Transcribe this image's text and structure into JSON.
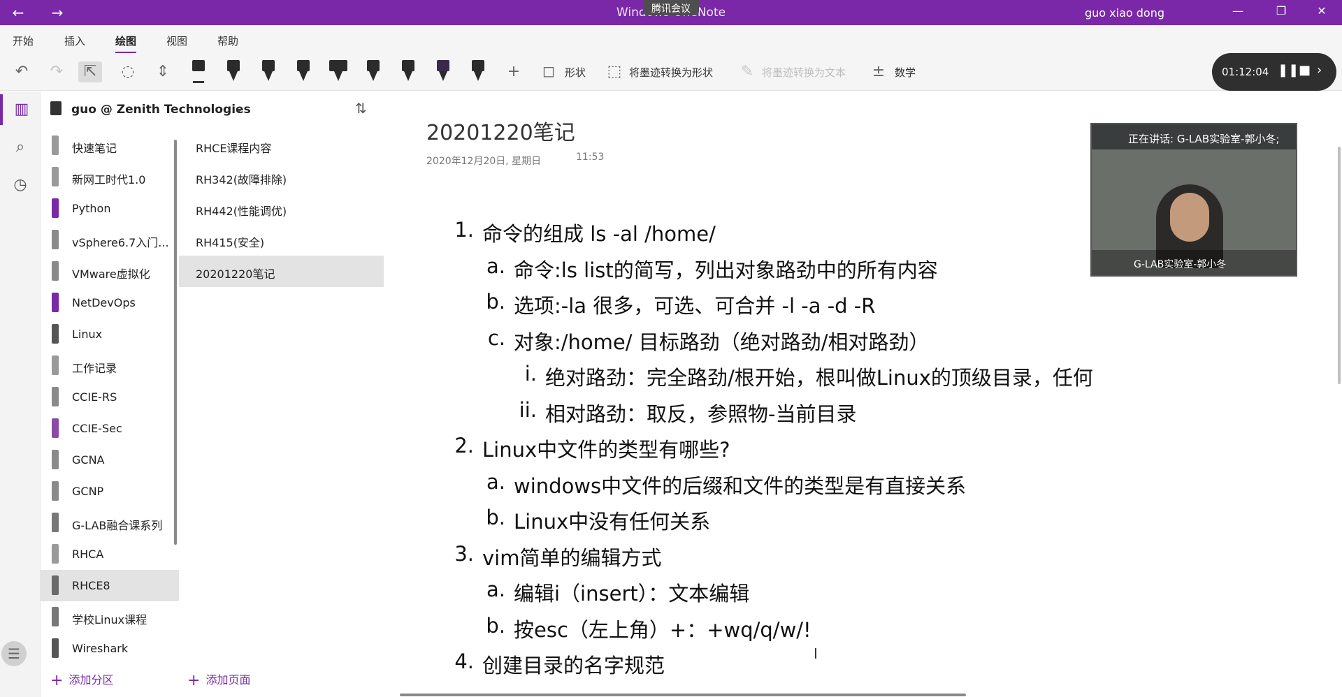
{
  "titlebar": {
    "title": "Windows OneNote",
    "meeting_badge": "腾讯会议",
    "user": "guo xiao dong",
    "minimize": "—",
    "restore": "❐",
    "close": "✕"
  },
  "ribbon": {
    "tabs": [
      "开始",
      "插入",
      "绘图",
      "视图",
      "帮助"
    ],
    "active_tab": "绘图",
    "tools": {
      "shapes": "形状",
      "ink_to_shape": "将墨迹转换为形状",
      "ink_to_text": "将墨迹转换为文本",
      "math": "数学"
    }
  },
  "notebook": {
    "name": "guo @ Zenith Technologies"
  },
  "sections": [
    {
      "label": "快速笔记",
      "color": "#9a9a9a"
    },
    {
      "label": "新网工时代1.0",
      "color": "#9a9a9a"
    },
    {
      "label": "Python",
      "color": "#7a28a8"
    },
    {
      "label": "vSphere6.7入门...",
      "color": "#8a8a8a"
    },
    {
      "label": "VMware虚拟化",
      "color": "#8a8a8a"
    },
    {
      "label": "NetDevOps",
      "color": "#7a28a8"
    },
    {
      "label": "Linux",
      "color": "#555555"
    },
    {
      "label": "工作记录",
      "color": "#9a9a9a"
    },
    {
      "label": "CCIE-RS",
      "color": "#8a8a8a"
    },
    {
      "label": "CCIE-Sec",
      "color": "#8a4aa8"
    },
    {
      "label": "GCNA",
      "color": "#8a8a8a"
    },
    {
      "label": "GCNP",
      "color": "#8a8a8a"
    },
    {
      "label": "G-LAB融合课系列",
      "color": "#777777"
    },
    {
      "label": "RHCA",
      "color": "#9a9a9a"
    },
    {
      "label": "RHCE8",
      "color": "#6a6a6a"
    },
    {
      "label": "学校Linux课程",
      "color": "#777777"
    },
    {
      "label": "Wireshark",
      "color": "#555555"
    }
  ],
  "selected_section": "RHCE8",
  "pages": [
    "RHCE课程内容",
    "RH342(故障排除)",
    "RH442(性能调优)",
    "RH415(安全)",
    "20201220笔记"
  ],
  "selected_page": "20201220笔记",
  "add_section": "添加分区",
  "add_page": "添加页面",
  "note": {
    "title": "20201220笔记",
    "date": "2020年12月20日, 星期日",
    "time": "11:53",
    "lines": [
      {
        "num": "1.",
        "text": "命令的组成 ls -al /home/",
        "level": 0
      },
      {
        "num": "a.",
        "text": "命令:ls  list的简写，列出对象路劲中的所有内容",
        "level": 1
      },
      {
        "num": "b.",
        "text": "选项:-la    很多，可选、可合并 -l -a -d -R",
        "level": 1
      },
      {
        "num": "c.",
        "text": "对象:/home/ 目标路劲（绝对路劲/相对路劲）",
        "level": 1
      },
      {
        "num": "i.",
        "text": "绝对路劲：完全路劲/根开始，根叫做Linux的顶级目录，任何",
        "level": 2
      },
      {
        "num": "ii.",
        "text": "相对路劲：取反，参照物-当前目录",
        "level": 2
      },
      {
        "num": "2.",
        "text": "Linux中文件的类型有哪些?",
        "level": 0
      },
      {
        "num": "a.",
        "text": "windows中文件的后缀和文件的类型是有直接关系",
        "level": 1
      },
      {
        "num": "b.",
        "text": "Linux中没有任何关系",
        "level": 1
      },
      {
        "num": "3.",
        "text": "vim简单的编辑方式",
        "level": 0
      },
      {
        "num": "a.",
        "text": "编辑i（insert）：文本编辑",
        "level": 1
      },
      {
        "num": "b.",
        "text": "按esc（左上角）+：+wq/q/w/!",
        "level": 1
      },
      {
        "num": "4.",
        "text": "创建目录的名字规范",
        "level": 0
      }
    ]
  },
  "video": {
    "speaking": "正在讲话: G-LAB实验室-郭小冬;",
    "participant": "G-LAB实验室-郭小冬"
  },
  "timer": {
    "elapsed": "01:12:04"
  }
}
